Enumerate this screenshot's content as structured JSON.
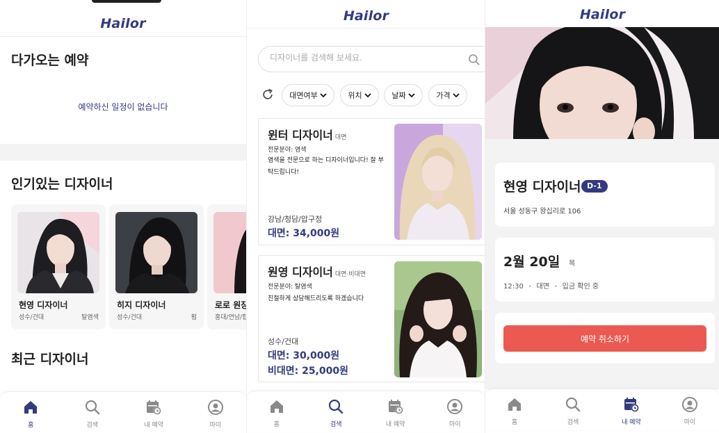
{
  "colors": {
    "brand": "#333a80",
    "danger": "#eb5a52",
    "nav_inactive": "#888888"
  },
  "app": {
    "logo": "Hailor"
  },
  "home": {
    "upcoming_title": "다가오는 예약",
    "upcoming_empty": "예약하신 일정이 없습니다",
    "popular_title": "인기있는 디자이너",
    "popular": [
      {
        "name": "현영 디자이너",
        "location": "성수/건대",
        "specialty": "탈염색"
      },
      {
        "name": "히지 디자이너",
        "location": "성수/건대",
        "specialty": "펌"
      },
      {
        "name": "로로 원장",
        "location": "홍대/연남/합정",
        "specialty": ""
      }
    ],
    "recent_title": "최근 디자이너"
  },
  "search": {
    "placeholder": "디자이너를 검색해 보세요.",
    "filters": [
      "대면여부",
      "위치",
      "날짜",
      "가격"
    ],
    "results": [
      {
        "name": "윈터 디자이너",
        "mode": "대면",
        "field": "전문분야: 염색",
        "desc": "염색을 전문으로 하는 디자이너입니다! 잘 부탁드립니다!",
        "location": "강남/청담/압구정",
        "price1": "대면: 34,000원",
        "price2": ""
      },
      {
        "name": "원영 디자이너",
        "mode": "대면·비대면",
        "field": "전문분야: 탈염색",
        "desc": "친절하게 상담해드리도록 하겠습니다",
        "location": "성수/건대",
        "price1": "대면: 30,000원",
        "price2": "비대면: 25,000원"
      }
    ]
  },
  "reservation": {
    "designer": "현영 디자이너",
    "dday": "D-1",
    "address": "서울 성동구 왕십리로 106",
    "date": "2월 20일",
    "weekday": "목",
    "time": "12:30",
    "mode": "대면",
    "status": "입금 확인 중",
    "cancel_label": "예약 취소하기"
  },
  "nav": {
    "home": "홈",
    "search": "검색",
    "booking": "내 예약",
    "my": "마이"
  }
}
